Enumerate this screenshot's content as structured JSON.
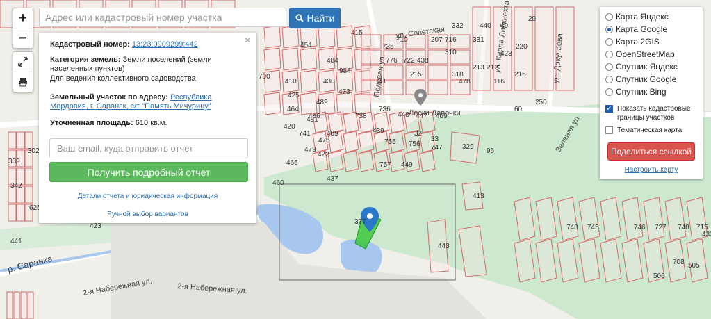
{
  "search": {
    "placeholder": "Адрес или кадастровый номер участка",
    "button_label": "Найти"
  },
  "controls": {
    "zoom_in": "+",
    "zoom_out": "−"
  },
  "info": {
    "cadastral_label": "Кадастровый номер:",
    "cadastral_value": "13:23:0909299:442",
    "category_label": "Категория земель:",
    "category_value": "Земли поселений (земли населенных пунктов)",
    "usage": "Для ведения коллективного садоводства",
    "address_label": "Земельный участок по адресу:",
    "address_value": "Республика Мордовия, г. Саранск, с/т \"Память Мичурину\"",
    "area_label": "Уточненная площадь:",
    "area_value": "610 кв.м.",
    "email_placeholder": "Ваш email, куда отправить отчет",
    "report_button": "Получить подробный отчет",
    "details_link": "Детали отчета и юридическая информация",
    "manual_link": "Ручной выбор вариантов",
    "close": "×"
  },
  "layers": {
    "options": [
      {
        "label": "Карта Яндекс",
        "selected": false
      },
      {
        "label": "Карта Google",
        "selected": true
      },
      {
        "label": "Карта 2GIS",
        "selected": false
      },
      {
        "label": "OpenStreetMap",
        "selected": false
      },
      {
        "label": "Спутник Яндекс",
        "selected": false
      },
      {
        "label": "Спутник Google",
        "selected": false
      },
      {
        "label": "Спутник Bing",
        "selected": false
      }
    ],
    "show_cadastral": "Показать кадастровые границы участков",
    "show_cadastral_checked": true,
    "thematic": "Тематическая карта",
    "thematic_checked": false,
    "share_button": "Поделиться ссылкой",
    "setup_link": "Настроить карту"
  },
  "map": {
    "streets": [
      "ул. Советская",
      "ул. Карла Либкнехта",
      "ул. Докучаева",
      "Полевая ул.",
      "Зеленая ул.",
      "2-я Набережная ул.",
      "2-я Набережная ул."
    ],
    "river": "р. Саранка",
    "place": "Лески Давочки",
    "parcel_numbers": [
      "415",
      "454",
      "484",
      "473",
      "410",
      "464",
      "984",
      "430",
      "425",
      "700",
      "489",
      "420",
      "479",
      "476",
      "489",
      "741",
      "465",
      "422",
      "481",
      "486",
      "738",
      "736",
      "439",
      "448",
      "447",
      "469",
      "755",
      "756",
      "757",
      "449",
      "460",
      "437",
      "441",
      "329",
      "413",
      "423",
      "625",
      "342",
      "339",
      "302",
      "377",
      "443",
      "748",
      "745",
      "746",
      "727",
      "748",
      "715",
      "708",
      "505",
      "506",
      "433",
      "332",
      "331",
      "310",
      "318",
      "212",
      "116",
      "213",
      "207",
      "20",
      "40",
      "41",
      "215",
      "32",
      "33",
      "96",
      "60",
      "250",
      "220",
      "215",
      "423",
      "440",
      "478",
      "747",
      "776",
      "722",
      "438",
      "716",
      "710",
      "735"
    ]
  },
  "colors": {
    "water": "#a8c7ee",
    "green": "#cce8cf",
    "parcel_line": "#d66a6a",
    "selected_parcel": "#3cc83c",
    "pin": "#2b78c8"
  }
}
